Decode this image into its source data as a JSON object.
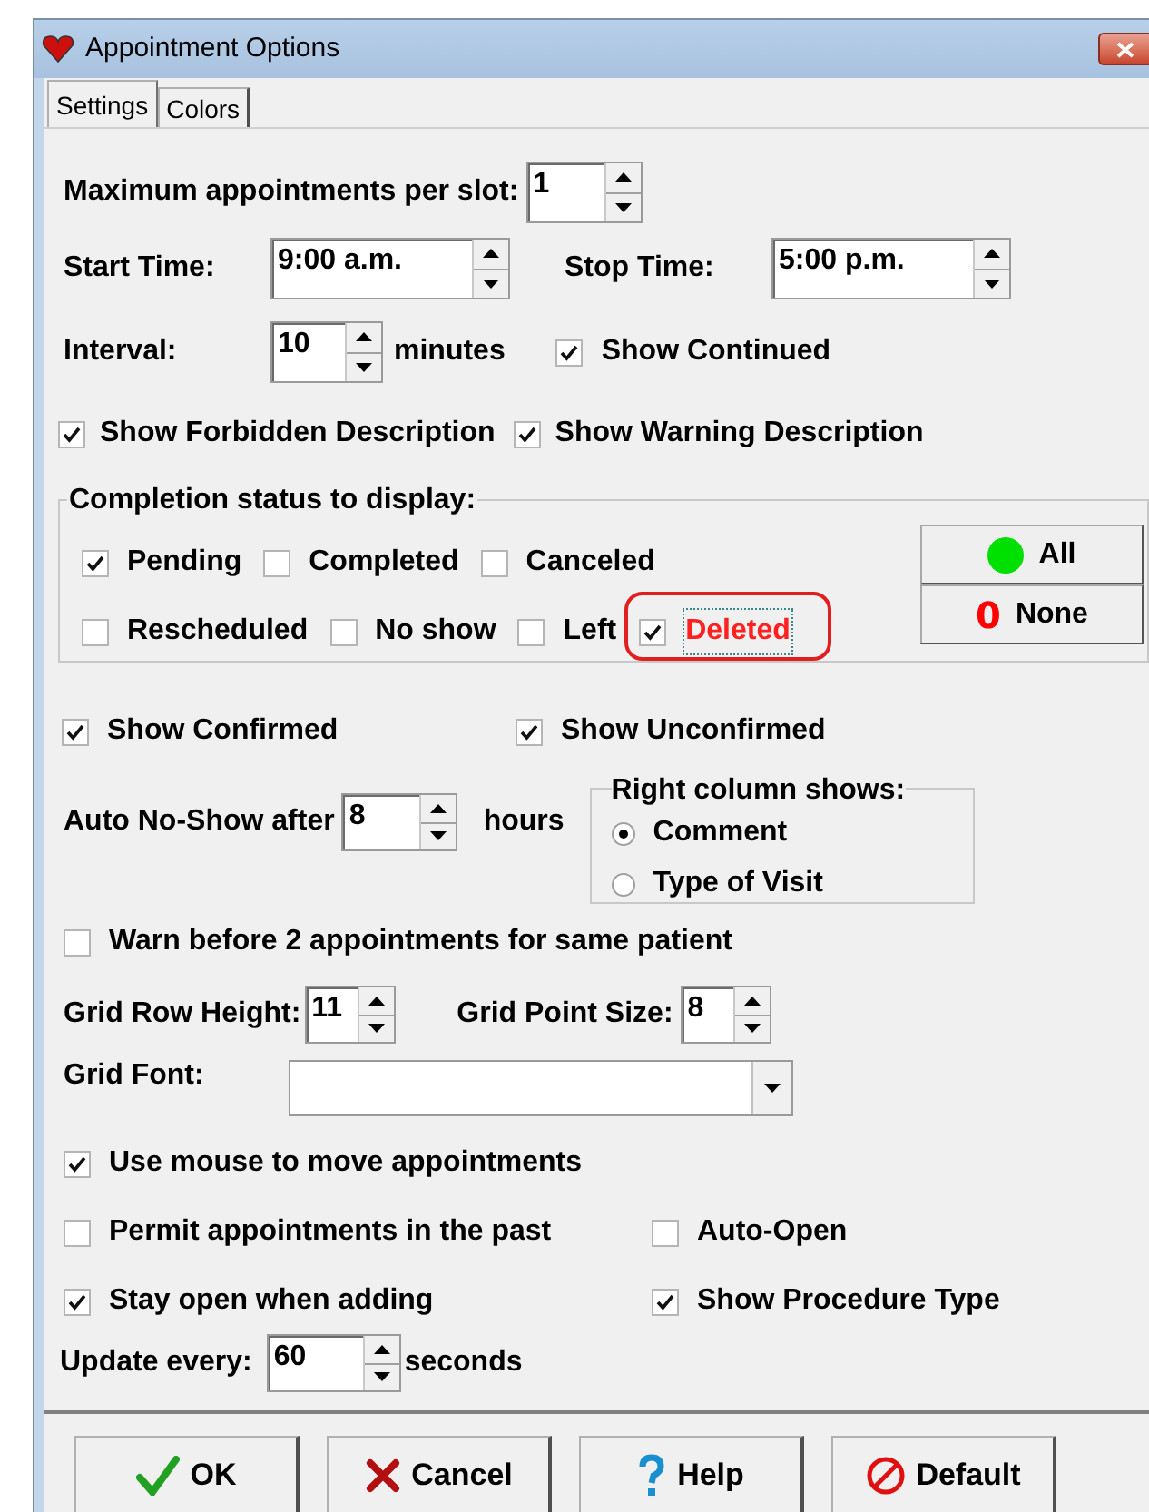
{
  "window": {
    "title": "Appointment Options"
  },
  "tabs": [
    {
      "label": "Settings",
      "selected": true
    },
    {
      "label": "Colors",
      "selected": false
    }
  ],
  "max_appointments": {
    "label": "Maximum appointments per slot:",
    "value": "1"
  },
  "start_time": {
    "label": "Start Time:",
    "value": "9:00 a.m."
  },
  "stop_time": {
    "label": "Stop Time:",
    "value": "5:00 p.m."
  },
  "interval": {
    "label": "Interval:",
    "value": "10",
    "unit": "minutes"
  },
  "show_continued": {
    "label": "Show Continued",
    "checked": true
  },
  "show_forbidden": {
    "label": "Show Forbidden Description",
    "checked": true
  },
  "show_warning": {
    "label": "Show Warning Description",
    "checked": true
  },
  "completion": {
    "title": "Completion status to display:",
    "rows": [
      [
        {
          "label": "Pending",
          "checked": true,
          "highlighted": false
        },
        {
          "label": "Completed",
          "checked": false,
          "highlighted": false
        },
        {
          "label": "Canceled",
          "checked": false,
          "highlighted": false
        }
      ],
      [
        {
          "label": "Rescheduled",
          "checked": false,
          "highlighted": false
        },
        {
          "label": "No show",
          "checked": false,
          "highlighted": false
        },
        {
          "label": "Left",
          "checked": false,
          "highlighted": false
        },
        {
          "label": "Deleted",
          "checked": true,
          "highlighted": true
        }
      ]
    ],
    "buttons": [
      {
        "kind": "all",
        "label": "All"
      },
      {
        "kind": "none",
        "glyph": "0",
        "label": "None"
      }
    ]
  },
  "show_confirmed": {
    "label": "Show Confirmed",
    "checked": true
  },
  "show_unconfirmed": {
    "label": "Show Unconfirmed",
    "checked": true
  },
  "auto_no_show": {
    "label": "Auto No-Show after",
    "value": "8",
    "unit": "hours"
  },
  "right_column": {
    "title": "Right column shows:",
    "options": [
      {
        "label": "Comment",
        "selected": true
      },
      {
        "label": "Type of Visit",
        "selected": false
      }
    ]
  },
  "warn_before": {
    "label": "Warn before 2 appointments for same patient",
    "checked": false
  },
  "grid_row_height": {
    "label": "Grid Row Height:",
    "value": "11"
  },
  "grid_point_size": {
    "label": "Grid Point Size:",
    "value": "8"
  },
  "grid_font": {
    "label": "Grid Font:"
  },
  "use_mouse": {
    "label": "Use mouse to move appointments",
    "checked": true
  },
  "permit_past": {
    "label": "Permit appointments in the past",
    "checked": false
  },
  "auto_open": {
    "label": "Auto-Open",
    "checked": false
  },
  "stay_open": {
    "label": "Stay open when adding",
    "checked": true
  },
  "show_procedure": {
    "label": "Show Procedure Type",
    "checked": true
  },
  "update_every": {
    "label": "Update every:",
    "value": "60",
    "unit": "seconds"
  },
  "buttons": [
    {
      "kind": "ok",
      "label": "OK"
    },
    {
      "kind": "cancel",
      "label": "Cancel"
    },
    {
      "kind": "help",
      "label": "Help"
    },
    {
      "kind": "default",
      "label": "Default"
    }
  ]
}
